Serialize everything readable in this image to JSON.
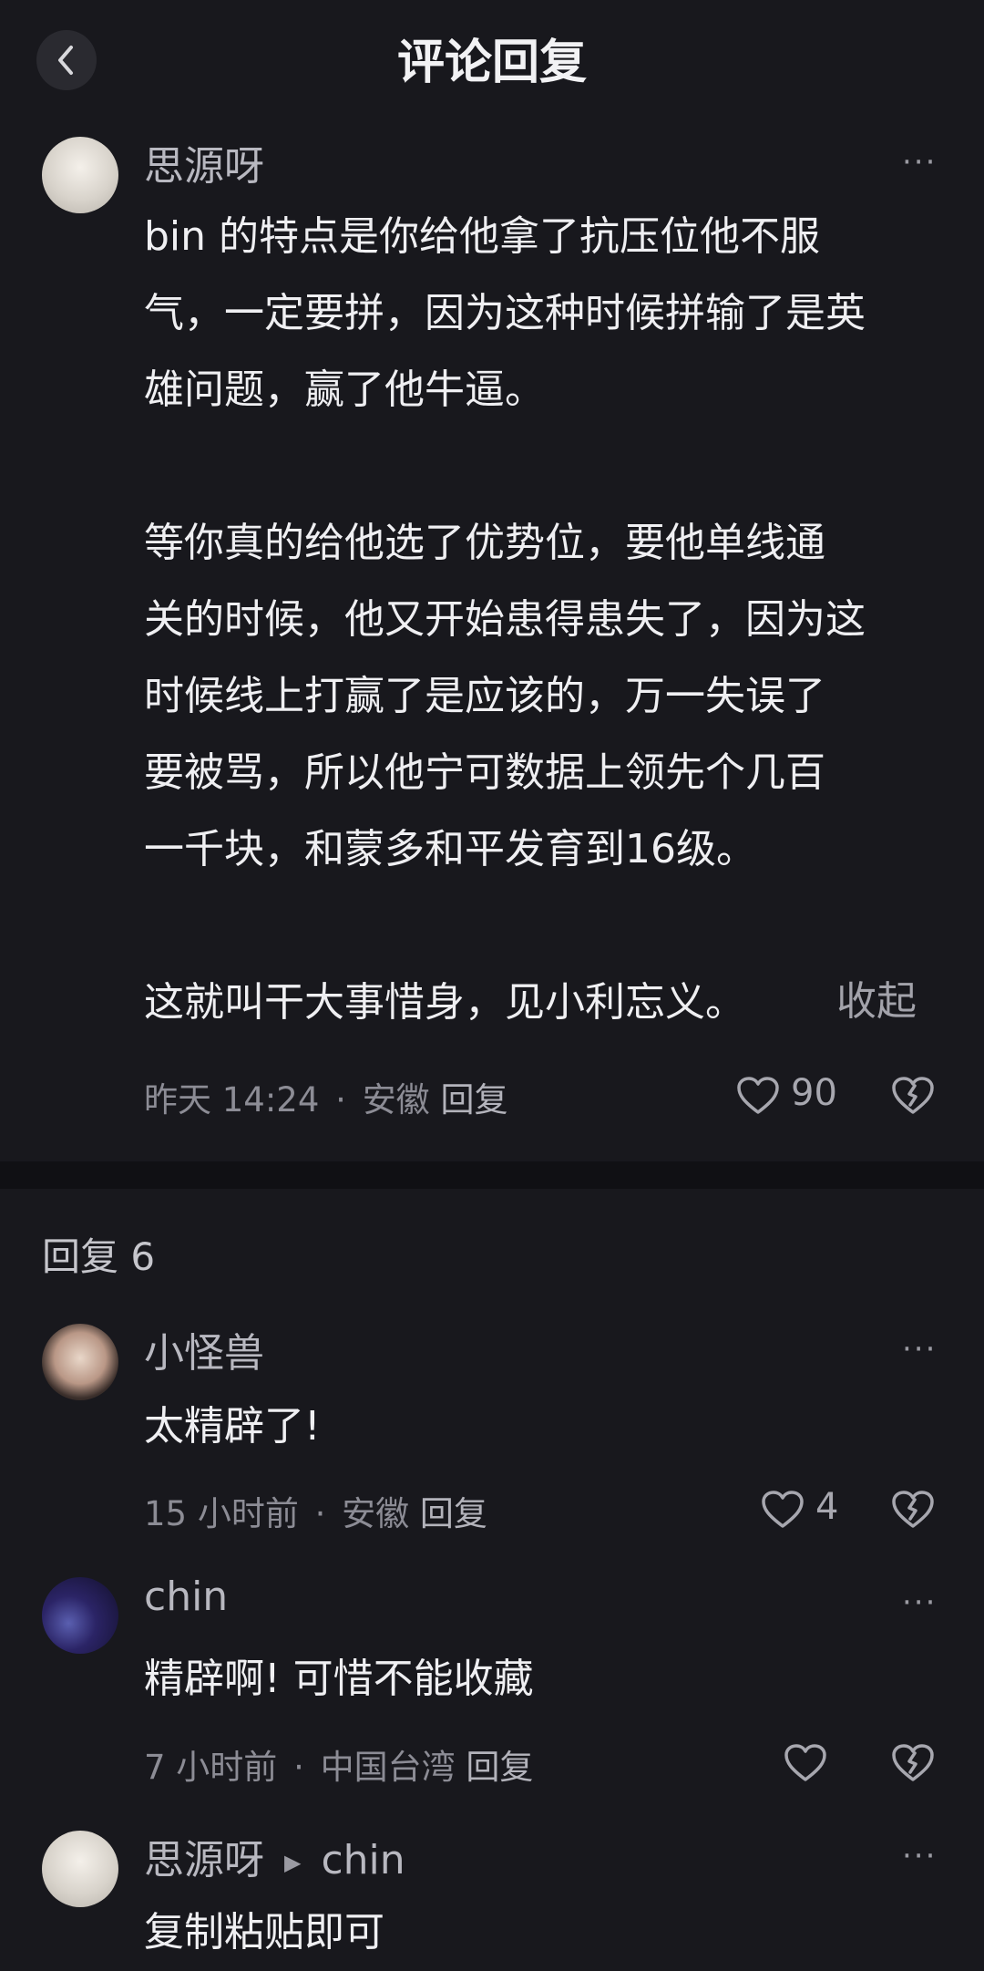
{
  "header": {
    "title": "评论回复",
    "back_icon": "chevron-left-icon"
  },
  "main_comment": {
    "author": "思源呀",
    "text": "bin 的特点是你给他拿了抗压位他不服\n气，一定要拼，因为这种时候拼输了是英\n雄问题，赢了他牛逼。\n\n等你真的给他选了优势位，要他单线通\n关的时候，他又开始患得患失了，因为这\n时候线上打赢了是应该的，万一失误了\n要被骂，所以他宁可数据上领先个几百\n一千块，和蒙多和平发育到16级。\n\n这就叫干大事惜身，见小利忘义。",
    "collapse_label": "收起",
    "time": "昨天 14:24",
    "location": "安徽",
    "reply_label": "回复",
    "likes": "90"
  },
  "replies_header": "回复 6",
  "replies": [
    {
      "author": "小怪兽",
      "text": "太精辟了!",
      "time": "15 小时前",
      "location": "安徽",
      "reply_label": "回复",
      "likes": "4"
    },
    {
      "author": "chin",
      "text": "精辟啊! 可惜不能收藏",
      "time": "7 小时前",
      "location": "中国台湾",
      "reply_label": "回复",
      "likes": ""
    },
    {
      "author": "思源呀",
      "reply_to": "chin",
      "text": "复制粘贴即可"
    }
  ],
  "separator_dot": "·",
  "more_glyph": "···",
  "colors": {
    "background": "#18181d",
    "text": "#efeff2",
    "secondary": "#8c8c95"
  }
}
